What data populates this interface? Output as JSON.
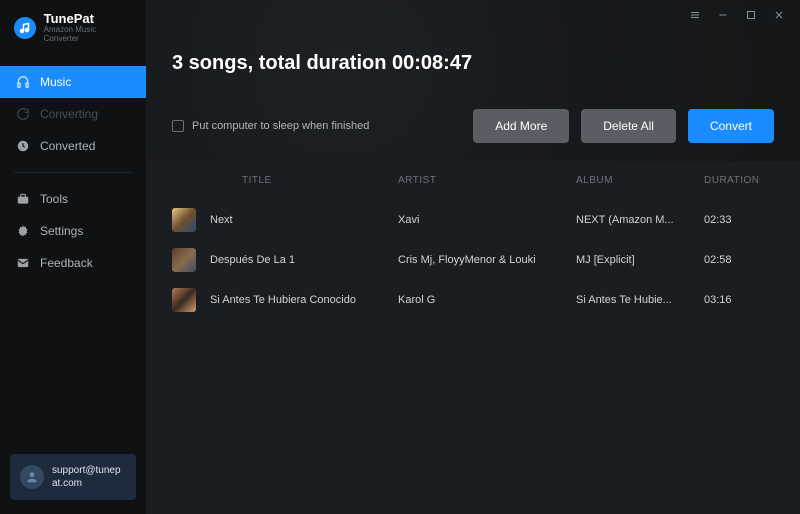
{
  "brand": {
    "title": "TunePat",
    "subtitle": "Amazon Music Converter"
  },
  "sidebar": {
    "items": [
      {
        "label": "Music"
      },
      {
        "label": "Converting"
      },
      {
        "label": "Converted"
      },
      {
        "label": "Tools"
      },
      {
        "label": "Settings"
      },
      {
        "label": "Feedback"
      }
    ]
  },
  "support": {
    "line1": "support@tunep",
    "line2": "at.com"
  },
  "summary": "3 songs, total duration 00:08:47",
  "sleep_label": "Put computer to sleep when finished",
  "buttons": {
    "add": "Add More",
    "delete": "Delete All",
    "convert": "Convert"
  },
  "columns": {
    "title": "TITLE",
    "artist": "ARTIST",
    "album": "ALBUM",
    "duration": "DURATION"
  },
  "tracks": [
    {
      "title": "Next",
      "artist": "Xavi",
      "album": "NEXT (Amazon M...",
      "duration": "02:33"
    },
    {
      "title": "Después De La 1",
      "artist": "Cris Mj, FloyyMenor & Louki",
      "album": "MJ [Explicit]",
      "duration": "02:58"
    },
    {
      "title": "Si Antes Te Hubiera Conocido",
      "artist": "Karol G",
      "album": "Si Antes Te Hubie...",
      "duration": "03:16"
    }
  ]
}
